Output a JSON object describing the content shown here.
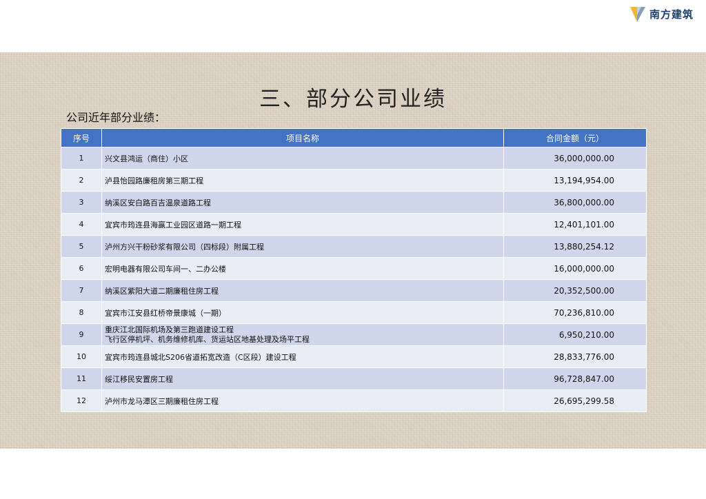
{
  "brand": {
    "name": "南方建筑",
    "logo_colors": [
      "#f2b632",
      "#8a9bb3"
    ]
  },
  "title": "三、部分公司业绩",
  "subtitle": "公司近年部分业绩：",
  "table": {
    "headers": [
      "序号",
      "项目名称",
      "合同金额（元）"
    ],
    "rows": [
      {
        "no": "1",
        "name": "兴文县鸿运（商住）小区",
        "amount": "36,000,000.00"
      },
      {
        "no": "2",
        "name": "泸县怡园路廉租房第三期工程",
        "amount": "13,194,954.00"
      },
      {
        "no": "3",
        "name": "纳溪区安白路百吉温泉道路工程",
        "amount": "36,800,000.00"
      },
      {
        "no": "4",
        "name": "宜宾市筠连县海赢工业园区道路一期工程",
        "amount": "12,401,101.00"
      },
      {
        "no": "5",
        "name": "泸州方兴干粉砂浆有限公司（四标段）附属工程",
        "amount": "13,880,254.12"
      },
      {
        "no": "6",
        "name": "宏明电器有限公司车间一、二办公楼",
        "amount": "16,000,000.00"
      },
      {
        "no": "7",
        "name": "纳溪区紫阳大道二期廉租住房工程",
        "amount": "20,352,500.00"
      },
      {
        "no": "8",
        "name": "宜宾市江安县红桥帝景康城（一期）",
        "amount": "70,236,810.00"
      },
      {
        "no": "9",
        "name_line1": "重庆江北国际机场及第三跑道建设工程",
        "name_line2": "飞行区停机坪、机务维修机库、货运站区地基处理及场平工程",
        "amount": "6,950,210.00"
      },
      {
        "no": "10",
        "name": "宜宾市筠连县城北S206省道拓宽改造（C区段）建设工程",
        "amount": "28,833,776.00"
      },
      {
        "no": "11",
        "name": "绥江移民安置房工程",
        "amount": "96,728,847.00"
      },
      {
        "no": "12",
        "name": "泸州市龙马潭区三期廉租住房工程",
        "amount": "26,695,299.58"
      }
    ]
  }
}
